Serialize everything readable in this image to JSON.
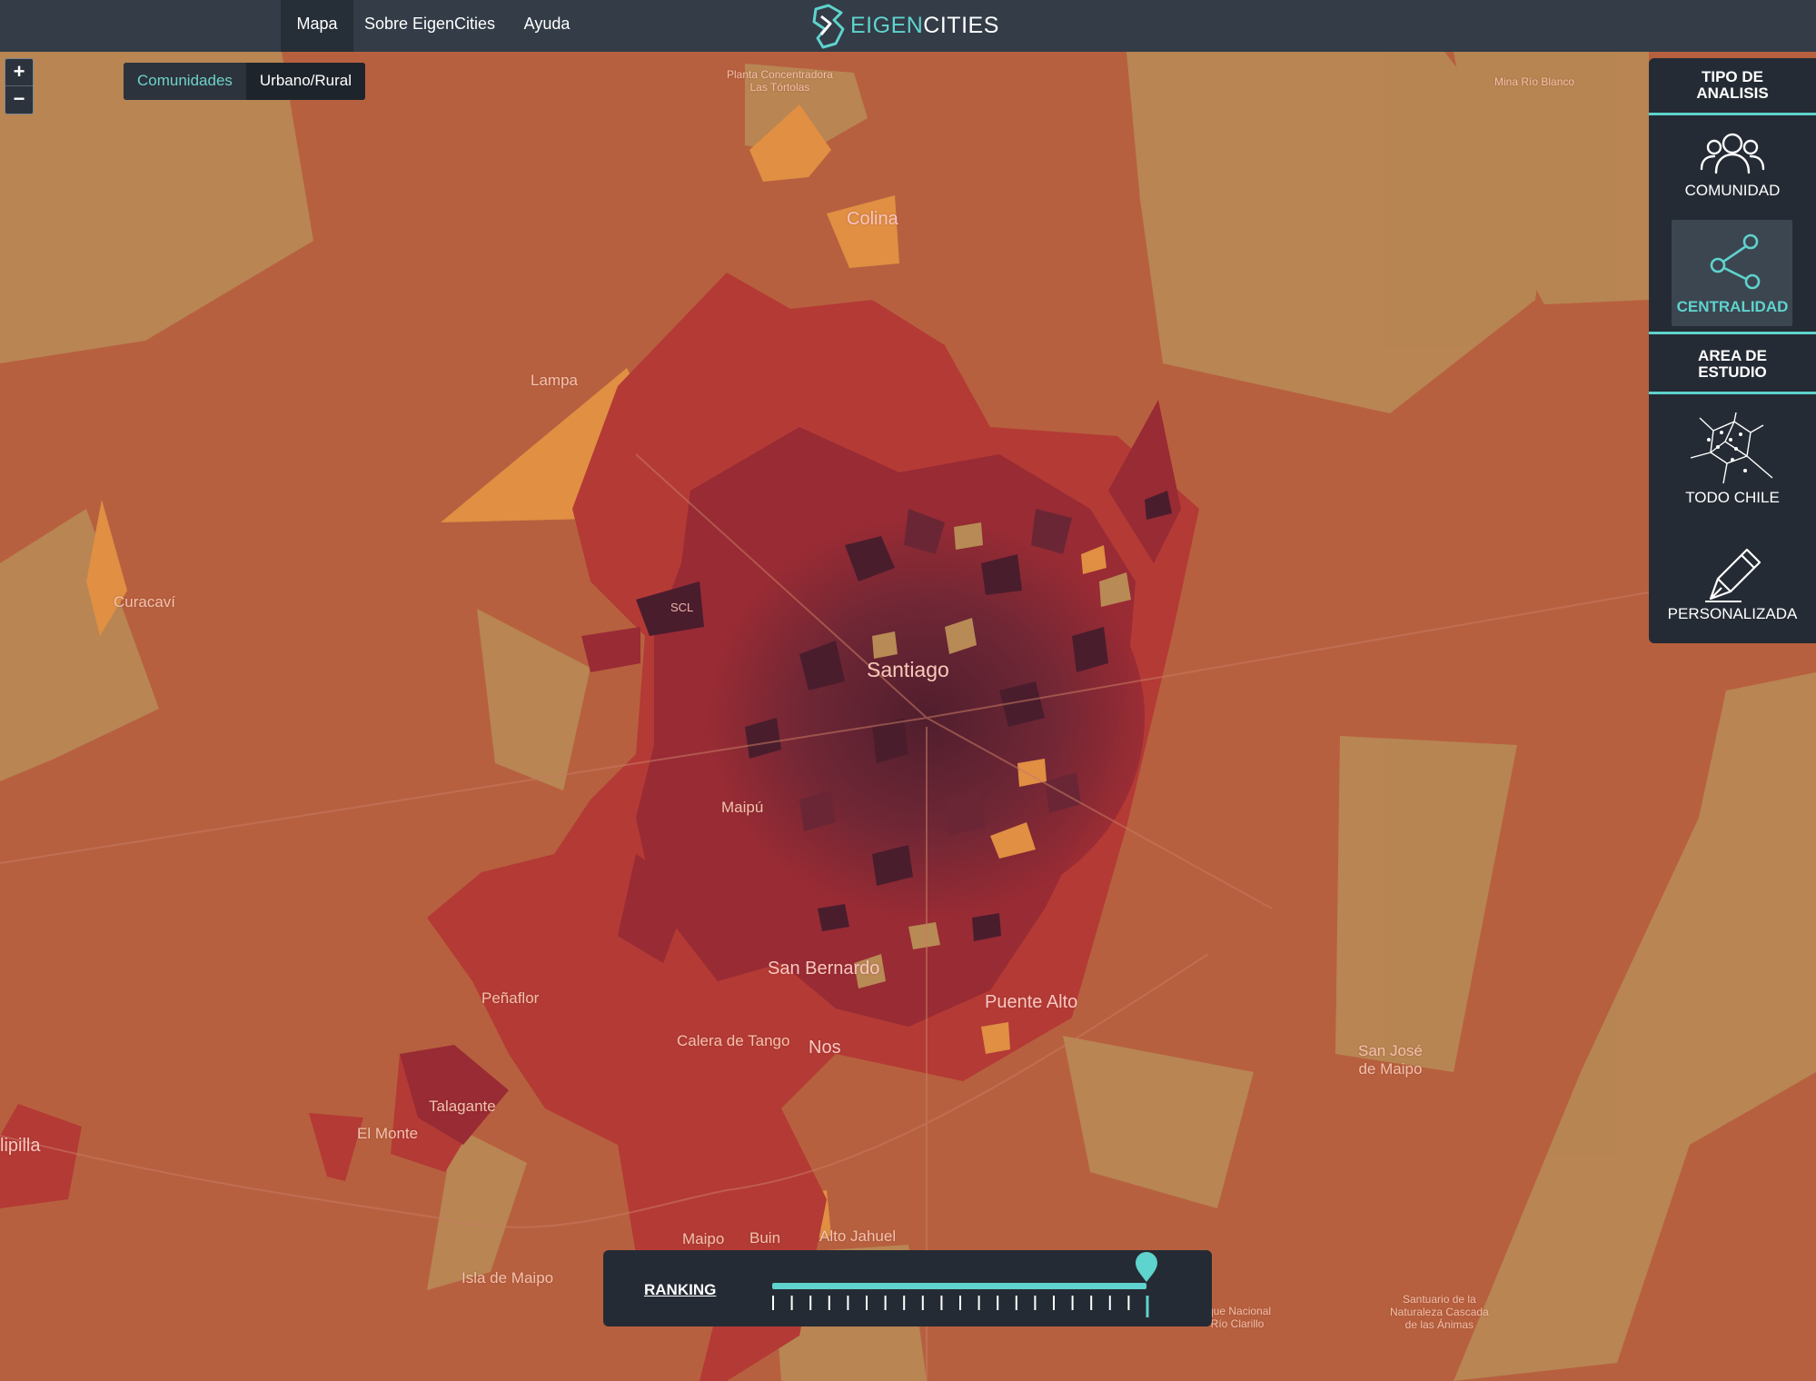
{
  "nav": {
    "items": [
      {
        "label": "Mapa",
        "active": true
      },
      {
        "label": "Sobre EigenCities",
        "active": false
      },
      {
        "label": "Ayuda",
        "active": false
      }
    ],
    "brand_part1": "EIGEN",
    "brand_part2": "CITIES"
  },
  "map_controls": {
    "zoom_in": "+",
    "zoom_out": "−",
    "toggle": {
      "options": [
        "Comunidades",
        "Urbano/Rural"
      ],
      "selected": "Comunidades"
    }
  },
  "panel": {
    "analysis_title": "TIPO DE ANALISIS",
    "analysis_title_line1": "TIPO DE",
    "analysis_title_line2": "ANALISIS",
    "analysis_options": [
      {
        "label": "COMUNIDAD",
        "icon": "users-icon",
        "active": false
      },
      {
        "label": "CENTRALIDAD",
        "icon": "network-icon",
        "active": true
      }
    ],
    "area_title": "AREA DE ESTUDIO",
    "area_title_line1": "AREA DE",
    "area_title_line2": "ESTUDIO",
    "area_options": [
      {
        "label": "TODO CHILE",
        "icon": "voronoi-icon"
      },
      {
        "label": "PERSONALIZADA",
        "icon": "pen-icon"
      }
    ]
  },
  "ranking": {
    "label": "RANKING",
    "value_fraction": 1.0,
    "tick_count": 21
  },
  "places": {
    "planta1": "Planta Concentradora",
    "planta2": "Las Tórtolas",
    "mina": "Mina Río Blanco",
    "colina": "Colina",
    "lampa": "Lampa",
    "curacavi": "Curacaví",
    "scl": "SCL",
    "santiago": "Santiago",
    "maipu": "Maipú",
    "san_bernardo": "San Bernardo",
    "puente_alto": "Puente Alto",
    "penaflor": "Peñaflor",
    "calera": "Calera de Tango",
    "nos": "Nos",
    "talagante": "Talagante",
    "el_monte": "El Monte",
    "melipilla": "lipilla",
    "san_jose1": "San José",
    "san_jose2": "de Maipo",
    "maipo": "Maipo",
    "buin": "Buin",
    "alto_jahuel": "Alto Jahuel",
    "isla": "Isla de Maipo",
    "rio_clarillo1": "rque Nacional",
    "rio_clarillo2": "Río Clarillo",
    "santuario1": "Santuario de la",
    "santuario2": "Naturaleza Cascada",
    "santuario3": "de las Ánimas"
  },
  "colors": {
    "accent": "#5fd3cd",
    "nav_bg": "#333c47",
    "panel_bg": "#252b34",
    "rank_1": "#4a1d2d",
    "rank_2": "#6b2635",
    "rank_3": "#982b34",
    "rank_4": "#b43a35",
    "rank_5": "#c05a3b",
    "rank_6": "#b88a55",
    "rank_7": "#e08f43"
  }
}
